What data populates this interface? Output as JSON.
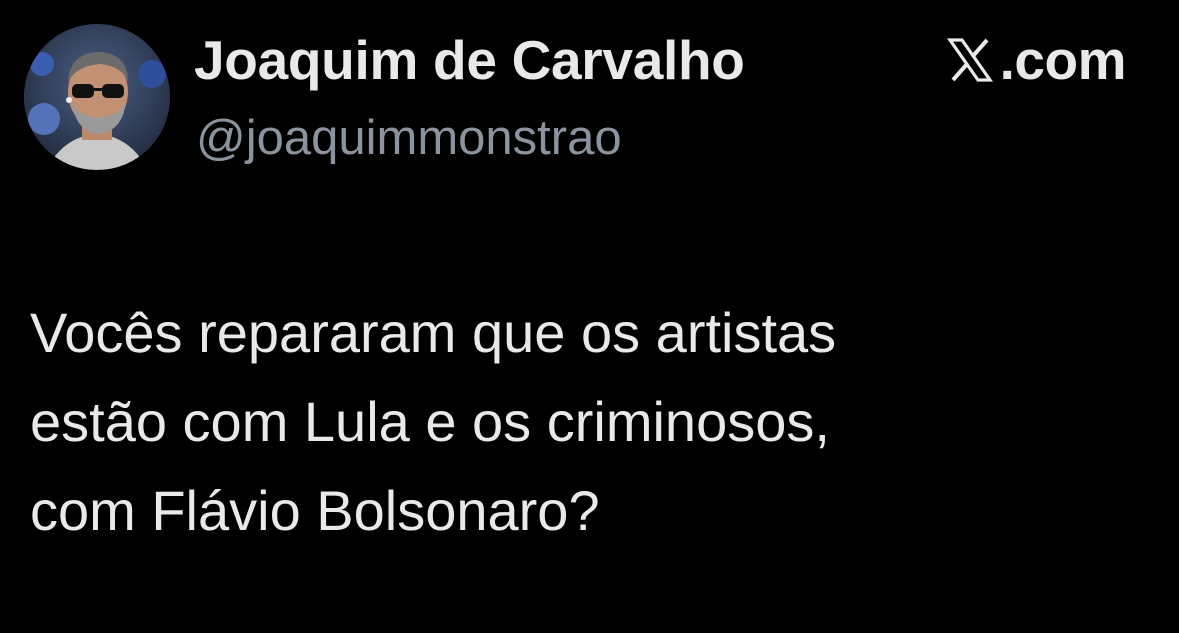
{
  "author": {
    "display_name": "Joaquim de Carvalho",
    "handle": "@joaquimmonstrao",
    "avatar_icon": "profile-photo"
  },
  "brand": {
    "icon": "x-logo-icon",
    "domain": ".com"
  },
  "tweet": {
    "lines": [
      "Vocês repararam que os artistas",
      "estão com Lula e os criminosos,",
      "com Flávio Bolsonaro?"
    ]
  },
  "colors": {
    "background": "#000000",
    "primary_text": "#e7e9ea",
    "secondary_text": "#8b949e"
  }
}
